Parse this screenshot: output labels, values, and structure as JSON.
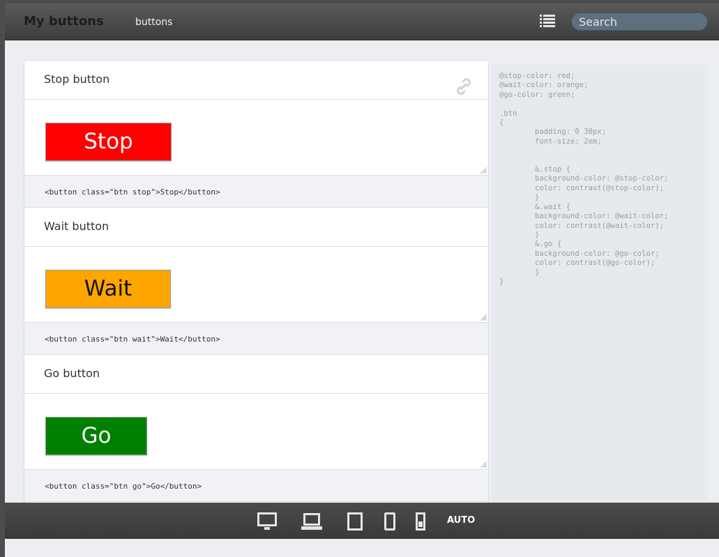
{
  "header": {
    "title": "My buttons",
    "subtitle": "buttons",
    "search_placeholder": "Search"
  },
  "cards": [
    {
      "heading": "Stop button",
      "button_label": "Stop",
      "code": "<button class=\"btn stop\">Stop</button>",
      "color": "#ff0000"
    },
    {
      "heading": "Wait button",
      "button_label": "Wait",
      "code": "<button class=\"btn wait\">Wait</button>",
      "color": "#ffa500"
    },
    {
      "heading": "Go button",
      "button_label": "Go",
      "code": "<button class=\"btn go\">Go</button>",
      "color": "#008000"
    }
  ],
  "css_source": "@stop-color: red;\n@wait-color: orange;\n@go-color: green;\n\n.btn\n{\n        padding: 0 30px;\n        font-size: 2em;\n\n\n        &.stop {\n        background-color: @stop-color;\n        color: contrast(@stop-color);\n        }\n        &.wait {\n        background-color: @wait-color;\n        color: contrast(@wait-color);\n        }\n        &.go {\n        background-color: @go-color;\n        color: contrast(@go-color);\n        }\n}",
  "footer": {
    "devices": [
      "desktop-icon",
      "laptop-icon",
      "tablet-icon",
      "phone-icon",
      "small-phone-icon"
    ],
    "auto_label": "AUTO"
  }
}
